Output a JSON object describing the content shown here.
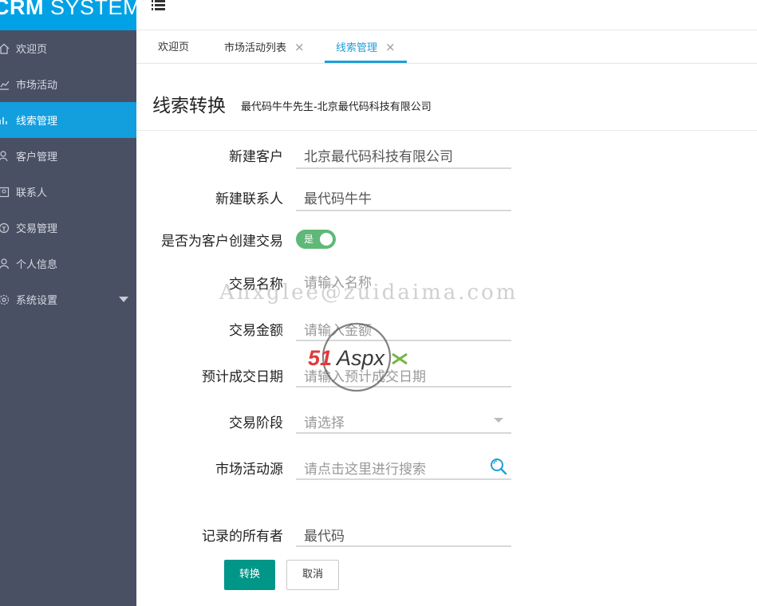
{
  "brand": {
    "bold": "CRM",
    "rest": " SYSTEM"
  },
  "sidebar": {
    "items": [
      {
        "label": "欢迎页",
        "icon": "home-icon"
      },
      {
        "label": "市场活动",
        "icon": "chart-icon"
      },
      {
        "label": "线索管理",
        "icon": "clue-icon",
        "active": true
      },
      {
        "label": "客户管理",
        "icon": "customer-icon"
      },
      {
        "label": "联系人",
        "icon": "contact-icon"
      },
      {
        "label": "交易管理",
        "icon": "transaction-icon"
      },
      {
        "label": "个人信息",
        "icon": "user-icon"
      },
      {
        "label": "系统设置",
        "icon": "settings-icon"
      }
    ]
  },
  "tabs": [
    {
      "label": "欢迎页"
    },
    {
      "label": "市场活动列表",
      "close": "×"
    },
    {
      "label": "线索管理",
      "close": "×",
      "active": true
    }
  ],
  "page": {
    "title": "线索转换",
    "subtitle": "最代码牛牛先生-北京最代码科技有限公司"
  },
  "form": {
    "new_customer": {
      "label": "新建客户",
      "value": "北京最代码科技有限公司"
    },
    "new_contact": {
      "label": "新建联系人",
      "value": "最代码牛牛"
    },
    "create_tx": {
      "label": "是否为客户创建交易",
      "toggle_text": "是"
    },
    "tx_name": {
      "label": "交易名称",
      "placeholder": "请输入名称"
    },
    "tx_amount": {
      "label": "交易金额",
      "placeholder": "请输入金额"
    },
    "tx_date": {
      "label": "预计成交日期",
      "placeholder": "请输入预计成交日期"
    },
    "tx_stage": {
      "label": "交易阶段",
      "placeholder": "请选择"
    },
    "activity_source": {
      "label": "市场活动源",
      "placeholder": "请点击这里进行搜索"
    },
    "owner": {
      "label": "记录的所有者",
      "value": "最代码"
    }
  },
  "buttons": {
    "convert": "转换",
    "cancel": "取消"
  },
  "watermark": {
    "text": "Anxglee@zuidaima.com",
    "logo_red": "51",
    "logo_dark": "Aspx"
  },
  "colors": {
    "sidebar": "#4a5064",
    "brand": "#00a2e5",
    "active_nav": "#139ede",
    "primary": "#009688",
    "switch_on": "#5fb878",
    "tab_active": "#1e9fd8"
  }
}
